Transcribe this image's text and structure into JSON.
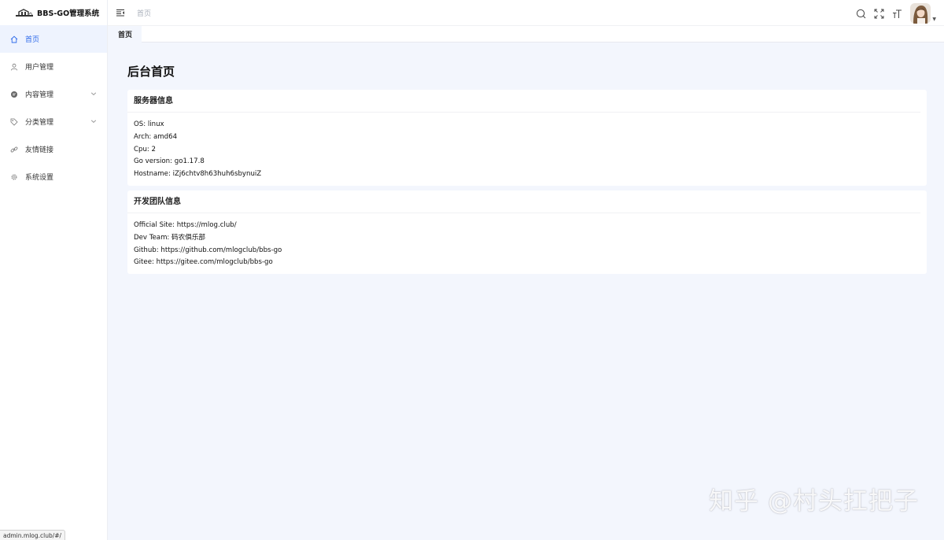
{
  "app": {
    "title": "BBS-GO管理系统"
  },
  "colors": {
    "accent": "#2f6bea",
    "sidebar_active_bg": "#eef3fe",
    "page_bg": "#f3f6fd"
  },
  "sidebar": {
    "items": [
      {
        "label": "首页",
        "icon": "home-icon",
        "active": true
      },
      {
        "label": "用户管理",
        "icon": "user-icon"
      },
      {
        "label": "内容管理",
        "icon": "content-icon",
        "has_children": true
      },
      {
        "label": "分类管理",
        "icon": "tag-icon",
        "has_children": true
      },
      {
        "label": "友情链接",
        "icon": "link-icon"
      },
      {
        "label": "系统设置",
        "icon": "gear-icon"
      }
    ]
  },
  "header": {
    "breadcrumb": "首页",
    "icons": [
      "search-icon",
      "fullscreen-icon",
      "font-size-icon",
      "avatar"
    ]
  },
  "tabs": [
    {
      "label": "首页"
    }
  ],
  "main": {
    "title": "后台首页",
    "server_info": {
      "title": "服务器信息",
      "lines": [
        "OS: linux",
        "Arch: amd64",
        "Cpu: 2",
        "Go version: go1.17.8",
        "Hostname: iZj6chtv8h63huh6sbynuiZ"
      ]
    },
    "team_info": {
      "title": "开发团队信息",
      "lines": [
        "Official Site: https://mlog.club/",
        "Dev Team: 码农俱乐部",
        "Github: https://github.com/mlogclub/bbs-go",
        "Gitee: https://gitee.com/mlogclub/bbs-go"
      ]
    }
  },
  "status_bar": {
    "url": "admin.mlog.club/#/"
  },
  "watermark": "知乎 @村头扛把子"
}
